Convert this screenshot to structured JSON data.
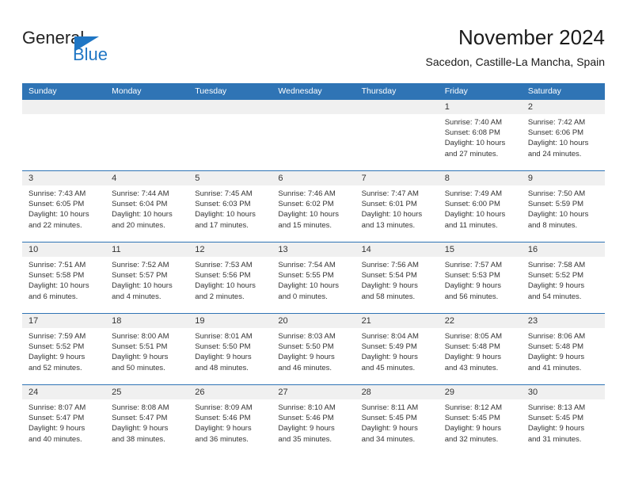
{
  "logo": {
    "word_one": "General",
    "word_two": "Blue",
    "triangle_icon": "triangle-icon",
    "accent_color": "#1F76C4"
  },
  "header": {
    "title": "November 2024",
    "subtitle": "Sacedon, Castille-La Mancha, Spain"
  },
  "calendar": {
    "header_color": "#2F74B5",
    "daynum_band_color": "#F0F0F0",
    "weekdays": [
      "Sunday",
      "Monday",
      "Tuesday",
      "Wednesday",
      "Thursday",
      "Friday",
      "Saturday"
    ],
    "weeks": [
      [
        {
          "day": "",
          "empty": true
        },
        {
          "day": "",
          "empty": true
        },
        {
          "day": "",
          "empty": true
        },
        {
          "day": "",
          "empty": true
        },
        {
          "day": "",
          "empty": true
        },
        {
          "day": "1",
          "sunrise": "Sunrise: 7:40 AM",
          "sunset": "Sunset: 6:08 PM",
          "daylight_1": "Daylight: 10 hours",
          "daylight_2": "and 27 minutes."
        },
        {
          "day": "2",
          "sunrise": "Sunrise: 7:42 AM",
          "sunset": "Sunset: 6:06 PM",
          "daylight_1": "Daylight: 10 hours",
          "daylight_2": "and 24 minutes."
        }
      ],
      [
        {
          "day": "3",
          "sunrise": "Sunrise: 7:43 AM",
          "sunset": "Sunset: 6:05 PM",
          "daylight_1": "Daylight: 10 hours",
          "daylight_2": "and 22 minutes."
        },
        {
          "day": "4",
          "sunrise": "Sunrise: 7:44 AM",
          "sunset": "Sunset: 6:04 PM",
          "daylight_1": "Daylight: 10 hours",
          "daylight_2": "and 20 minutes."
        },
        {
          "day": "5",
          "sunrise": "Sunrise: 7:45 AM",
          "sunset": "Sunset: 6:03 PM",
          "daylight_1": "Daylight: 10 hours",
          "daylight_2": "and 17 minutes."
        },
        {
          "day": "6",
          "sunrise": "Sunrise: 7:46 AM",
          "sunset": "Sunset: 6:02 PM",
          "daylight_1": "Daylight: 10 hours",
          "daylight_2": "and 15 minutes."
        },
        {
          "day": "7",
          "sunrise": "Sunrise: 7:47 AM",
          "sunset": "Sunset: 6:01 PM",
          "daylight_1": "Daylight: 10 hours",
          "daylight_2": "and 13 minutes."
        },
        {
          "day": "8",
          "sunrise": "Sunrise: 7:49 AM",
          "sunset": "Sunset: 6:00 PM",
          "daylight_1": "Daylight: 10 hours",
          "daylight_2": "and 11 minutes."
        },
        {
          "day": "9",
          "sunrise": "Sunrise: 7:50 AM",
          "sunset": "Sunset: 5:59 PM",
          "daylight_1": "Daylight: 10 hours",
          "daylight_2": "and 8 minutes."
        }
      ],
      [
        {
          "day": "10",
          "sunrise": "Sunrise: 7:51 AM",
          "sunset": "Sunset: 5:58 PM",
          "daylight_1": "Daylight: 10 hours",
          "daylight_2": "and 6 minutes."
        },
        {
          "day": "11",
          "sunrise": "Sunrise: 7:52 AM",
          "sunset": "Sunset: 5:57 PM",
          "daylight_1": "Daylight: 10 hours",
          "daylight_2": "and 4 minutes."
        },
        {
          "day": "12",
          "sunrise": "Sunrise: 7:53 AM",
          "sunset": "Sunset: 5:56 PM",
          "daylight_1": "Daylight: 10 hours",
          "daylight_2": "and 2 minutes."
        },
        {
          "day": "13",
          "sunrise": "Sunrise: 7:54 AM",
          "sunset": "Sunset: 5:55 PM",
          "daylight_1": "Daylight: 10 hours",
          "daylight_2": "and 0 minutes."
        },
        {
          "day": "14",
          "sunrise": "Sunrise: 7:56 AM",
          "sunset": "Sunset: 5:54 PM",
          "daylight_1": "Daylight: 9 hours",
          "daylight_2": "and 58 minutes."
        },
        {
          "day": "15",
          "sunrise": "Sunrise: 7:57 AM",
          "sunset": "Sunset: 5:53 PM",
          "daylight_1": "Daylight: 9 hours",
          "daylight_2": "and 56 minutes."
        },
        {
          "day": "16",
          "sunrise": "Sunrise: 7:58 AM",
          "sunset": "Sunset: 5:52 PM",
          "daylight_1": "Daylight: 9 hours",
          "daylight_2": "and 54 minutes."
        }
      ],
      [
        {
          "day": "17",
          "sunrise": "Sunrise: 7:59 AM",
          "sunset": "Sunset: 5:52 PM",
          "daylight_1": "Daylight: 9 hours",
          "daylight_2": "and 52 minutes."
        },
        {
          "day": "18",
          "sunrise": "Sunrise: 8:00 AM",
          "sunset": "Sunset: 5:51 PM",
          "daylight_1": "Daylight: 9 hours",
          "daylight_2": "and 50 minutes."
        },
        {
          "day": "19",
          "sunrise": "Sunrise: 8:01 AM",
          "sunset": "Sunset: 5:50 PM",
          "daylight_1": "Daylight: 9 hours",
          "daylight_2": "and 48 minutes."
        },
        {
          "day": "20",
          "sunrise": "Sunrise: 8:03 AM",
          "sunset": "Sunset: 5:50 PM",
          "daylight_1": "Daylight: 9 hours",
          "daylight_2": "and 46 minutes."
        },
        {
          "day": "21",
          "sunrise": "Sunrise: 8:04 AM",
          "sunset": "Sunset: 5:49 PM",
          "daylight_1": "Daylight: 9 hours",
          "daylight_2": "and 45 minutes."
        },
        {
          "day": "22",
          "sunrise": "Sunrise: 8:05 AM",
          "sunset": "Sunset: 5:48 PM",
          "daylight_1": "Daylight: 9 hours",
          "daylight_2": "and 43 minutes."
        },
        {
          "day": "23",
          "sunrise": "Sunrise: 8:06 AM",
          "sunset": "Sunset: 5:48 PM",
          "daylight_1": "Daylight: 9 hours",
          "daylight_2": "and 41 minutes."
        }
      ],
      [
        {
          "day": "24",
          "sunrise": "Sunrise: 8:07 AM",
          "sunset": "Sunset: 5:47 PM",
          "daylight_1": "Daylight: 9 hours",
          "daylight_2": "and 40 minutes."
        },
        {
          "day": "25",
          "sunrise": "Sunrise: 8:08 AM",
          "sunset": "Sunset: 5:47 PM",
          "daylight_1": "Daylight: 9 hours",
          "daylight_2": "and 38 minutes."
        },
        {
          "day": "26",
          "sunrise": "Sunrise: 8:09 AM",
          "sunset": "Sunset: 5:46 PM",
          "daylight_1": "Daylight: 9 hours",
          "daylight_2": "and 36 minutes."
        },
        {
          "day": "27",
          "sunrise": "Sunrise: 8:10 AM",
          "sunset": "Sunset: 5:46 PM",
          "daylight_1": "Daylight: 9 hours",
          "daylight_2": "and 35 minutes."
        },
        {
          "day": "28",
          "sunrise": "Sunrise: 8:11 AM",
          "sunset": "Sunset: 5:45 PM",
          "daylight_1": "Daylight: 9 hours",
          "daylight_2": "and 34 minutes."
        },
        {
          "day": "29",
          "sunrise": "Sunrise: 8:12 AM",
          "sunset": "Sunset: 5:45 PM",
          "daylight_1": "Daylight: 9 hours",
          "daylight_2": "and 32 minutes."
        },
        {
          "day": "30",
          "sunrise": "Sunrise: 8:13 AM",
          "sunset": "Sunset: 5:45 PM",
          "daylight_1": "Daylight: 9 hours",
          "daylight_2": "and 31 minutes."
        }
      ]
    ]
  }
}
